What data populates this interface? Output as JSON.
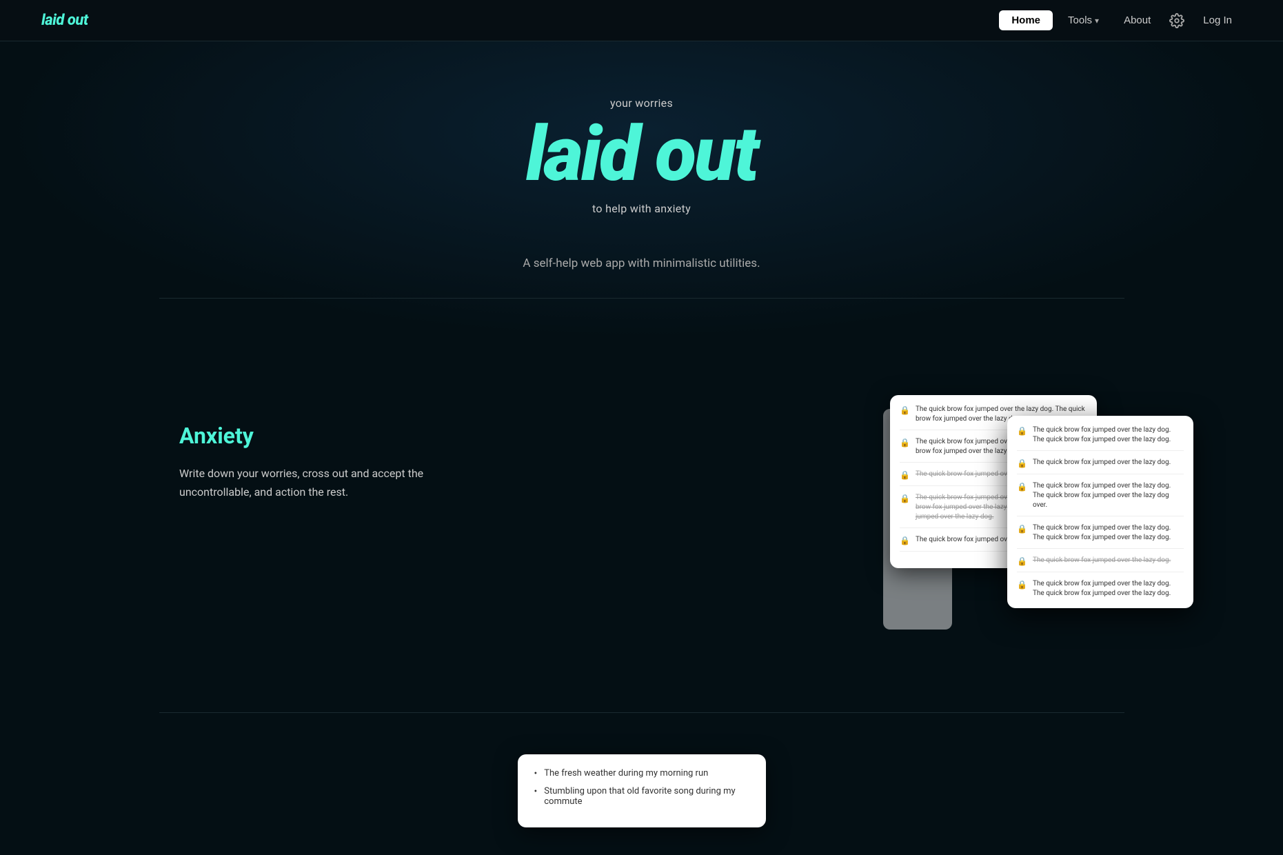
{
  "nav": {
    "logo": "laid out",
    "home_label": "Home",
    "tools_label": "Tools",
    "about_label": "About",
    "login_label": "Log In"
  },
  "hero": {
    "your_worries": "your worries",
    "title": "laid out",
    "subtitle": "to help with anxiety",
    "description": "A self-help web app with minimalistic utilities."
  },
  "anxiety_section": {
    "heading": "Anxiety",
    "body": "Write down your worries, cross out and accept the uncontrollable, and action the rest."
  },
  "mockup": {
    "entries": [
      {
        "text": "The quick brow fox jumped over the lazy dog. The quick brow fox jumped over the lazy dog.",
        "strikethrough": false
      },
      {
        "text": "The quick brow fox jumped over the lazy dog. The quick brow fox jumped over the lazy dog.",
        "strikethrough": false
      },
      {
        "text": "The quick brow fox jumped over the lazy dog.",
        "strikethrough": true
      },
      {
        "text": "The quick brow fox jumped over the lazy dog. The quick brow fox jumped over the lazy dog. The quick brow fox jumped over the lazy dog.",
        "strikethrough": true
      },
      {
        "text": "The quick brow fox jumped over the lazy dog. The quick brow fox jumped over the lazy dog.",
        "strikethrough": false
      },
      {
        "text": "The quick brow fox jumped over the lazy dog.",
        "strikethrough": false
      },
      {
        "text": "The quick brow fox jumped over the lazy dog. The quick brow fox jumped over the lazy dog over.",
        "strikethrough": false
      },
      {
        "text": "The quick brow fox jumped over the lazy dog. The quick brow fox jumped over the lazy dog.",
        "strikethrough": false
      },
      {
        "text": "The quick brow fox jumped over the lazy dog.",
        "strikethrough": true
      },
      {
        "text": "The quick brow fox jumped over the lazy dog. The quick brow fox jumped over the lazy dog.",
        "strikethrough": false
      }
    ]
  },
  "bottom_card": {
    "items": [
      "The fresh weather during my morning run",
      "Stumbling upon that old favorite song during my commute"
    ]
  }
}
